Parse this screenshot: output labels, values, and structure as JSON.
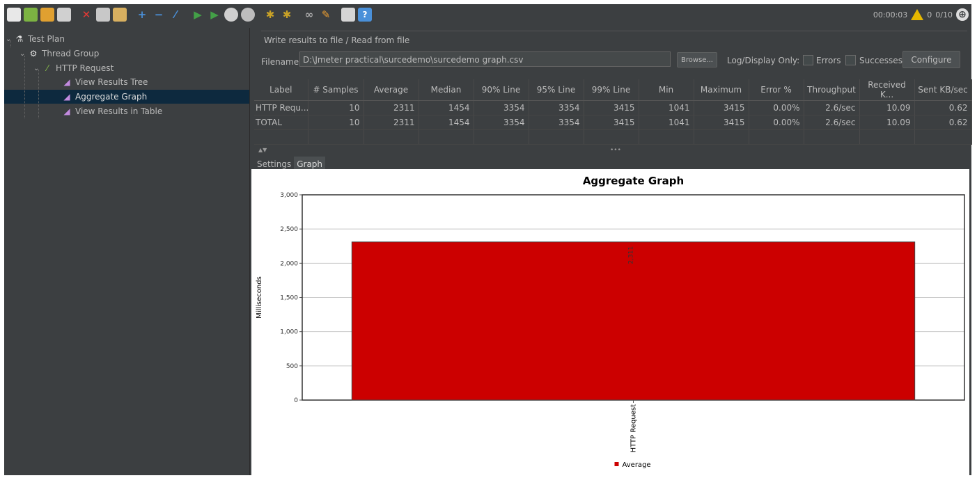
{
  "toolbar": {
    "icons": [
      "new-icon",
      "templates-icon",
      "open-icon",
      "save-icon",
      "cut-icon",
      "copy-icon",
      "paste-icon",
      "expand-icon",
      "collapse-icon",
      "toggle-icon",
      "start-icon",
      "start-no-pause-icon",
      "stop-icon",
      "shutdown-icon",
      "clear-icon",
      "clear-all-icon",
      "search-icon",
      "reset-search-icon",
      "function-helper-icon",
      "help-icon"
    ],
    "elapsed": "00:00:03",
    "warnings": "0",
    "threads": "0/10"
  },
  "tree": {
    "test_plan": "Test Plan",
    "thread_group": "Thread Group",
    "http_request": "HTTP Request",
    "listeners": [
      "View Results Tree",
      "Aggregate Graph",
      "View Results in Table"
    ]
  },
  "write_results": {
    "title": "Write results to file / Read from file",
    "filename_label": "Filename",
    "filename_value": "D:\\Jmeter practical\\surcedemo\\surcedemo graph.csv",
    "browse_label": "Browse...",
    "log_display_label": "Log/Display Only:",
    "errors_label": "Errors",
    "successes_label": "Successes",
    "configure_label": "Configure"
  },
  "table": {
    "headers": [
      "Label",
      "# Samples",
      "Average",
      "Median",
      "90% Line",
      "95% Line",
      "99% Line",
      "Min",
      "Maximum",
      "Error %",
      "Throughput",
      "Received K...",
      "Sent KB/sec"
    ],
    "rows": [
      [
        "HTTP Requ...",
        "10",
        "2311",
        "1454",
        "3354",
        "3354",
        "3415",
        "1041",
        "3415",
        "0.00%",
        "2.6/sec",
        "10.09",
        "0.62"
      ],
      [
        "TOTAL",
        "10",
        "2311",
        "1454",
        "3354",
        "3354",
        "3415",
        "1041",
        "3415",
        "0.00%",
        "2.6/sec",
        "10.09",
        "0.62"
      ]
    ]
  },
  "tabs": [
    "Settings",
    "Graph"
  ],
  "colors": {
    "bar": "#cc0000",
    "background": "#3c3f41",
    "selection": "#0d293e"
  },
  "chart_data": {
    "type": "bar",
    "title": "Aggregate Graph",
    "categories": [
      "HTTP Request"
    ],
    "series": [
      {
        "name": "Average",
        "values": [
          2311
        ]
      }
    ],
    "data_labels": [
      "2,311"
    ],
    "ylabel": "Milliseconds",
    "xlabel": "",
    "ylim": [
      0,
      3000
    ],
    "yticks": [
      "0",
      "500",
      "1,000",
      "1,500",
      "2,000",
      "2,500",
      "3,000"
    ],
    "grid": true,
    "legend": "bottom"
  }
}
